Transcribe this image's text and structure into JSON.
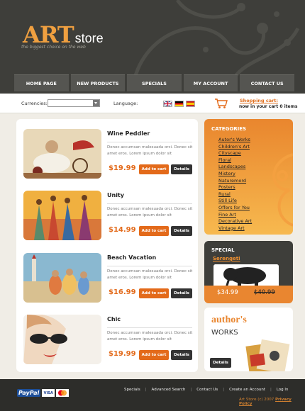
{
  "brand": {
    "logo_main": "ART",
    "logo_sub": "store",
    "slogan": "the biggest choice on the web"
  },
  "nav": {
    "items": [
      "HOME PAGE",
      "NEW PRODUCTS",
      "SPECIALS",
      "MY ACCOUNT",
      "CONTACT US"
    ]
  },
  "toolbar": {
    "currencies_label": "Currencies:",
    "currency_value": "",
    "language_label": "Language:",
    "languages": [
      "english-flag",
      "german-flag",
      "spanish-flag"
    ],
    "cart_title": "Shopping cart:",
    "cart_status": "now in your cart 0 items"
  },
  "products": [
    {
      "name": "Wine Peddler",
      "desc": "Donec accumsan malesuada orci. Donec sit amet eros. Lorem ipsum dolor sit",
      "price": "$19.99",
      "add_label": "Add to cart",
      "details_label": "Details"
    },
    {
      "name": "Unity",
      "desc": "Donec accumsan malesuada orci. Donec sit amet eros. Lorem ipsum dolor sit",
      "price": "$14.99",
      "add_label": "Add to cart",
      "details_label": "Details"
    },
    {
      "name": "Beach Vacation",
      "desc": "Donec accumsan malesuada orci. Donec sit amet eros. Lorem ipsum dolor sit",
      "price": "$16.99",
      "add_label": "Add to cart",
      "details_label": "Details"
    },
    {
      "name": "Chic",
      "desc": "Donec accumsan malesuada orci. Donec sit amet eros. Lorem ipsum dolor sit",
      "price": "$19.99",
      "add_label": "Add to cart",
      "details_label": "Details"
    }
  ],
  "categories": {
    "title": "CATEGORIES",
    "items": [
      "Autor's Works",
      "Children's Art",
      "Cityscape",
      "Floral",
      "Landscapes",
      "Mistery",
      "Naturemord",
      "Posters",
      "Rural",
      "Still Life",
      "Offers for You",
      "Fine Art",
      "Decorative Art",
      "Vintage Art"
    ]
  },
  "special": {
    "title": "SPECIAL",
    "name": "Serengeti",
    "price": "$34.99",
    "old_price": "$40.99"
  },
  "author": {
    "title": "author's",
    "works": "WORKS",
    "details_label": "Details"
  },
  "footer": {
    "links": [
      "Specials",
      "Advanced Search",
      "Contact Us",
      "Create an Account",
      "Log In"
    ],
    "copyright": "Art Store (c) 2007",
    "privacy": "Privacy Policy",
    "payments": [
      "PayPal",
      "VISA",
      "MasterCard"
    ]
  },
  "colors": {
    "accent": "#e36a1a",
    "dark": "#3e3e3a",
    "orange_panel": "#e9862e"
  }
}
